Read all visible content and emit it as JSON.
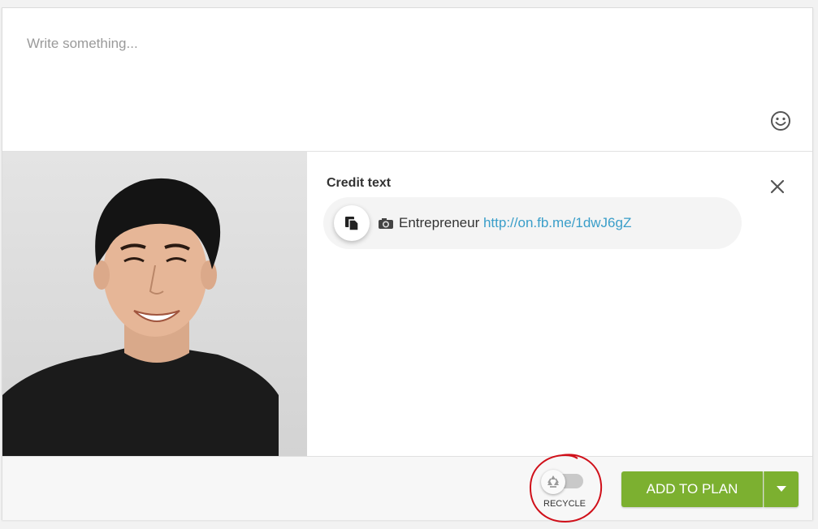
{
  "composer": {
    "placeholder": "Write something..."
  },
  "credit": {
    "title": "Credit text",
    "label": "Entrepreneur",
    "link": "http://on.fb.me/1dwJ6gZ"
  },
  "footer": {
    "recycle_label": "RECYCLE",
    "recycle_enabled": false,
    "add_to_plan_label": "ADD TO PLAN"
  },
  "colors": {
    "accent": "#7cb030",
    "link": "#3a9ec9",
    "annotation": "#d0101a"
  }
}
